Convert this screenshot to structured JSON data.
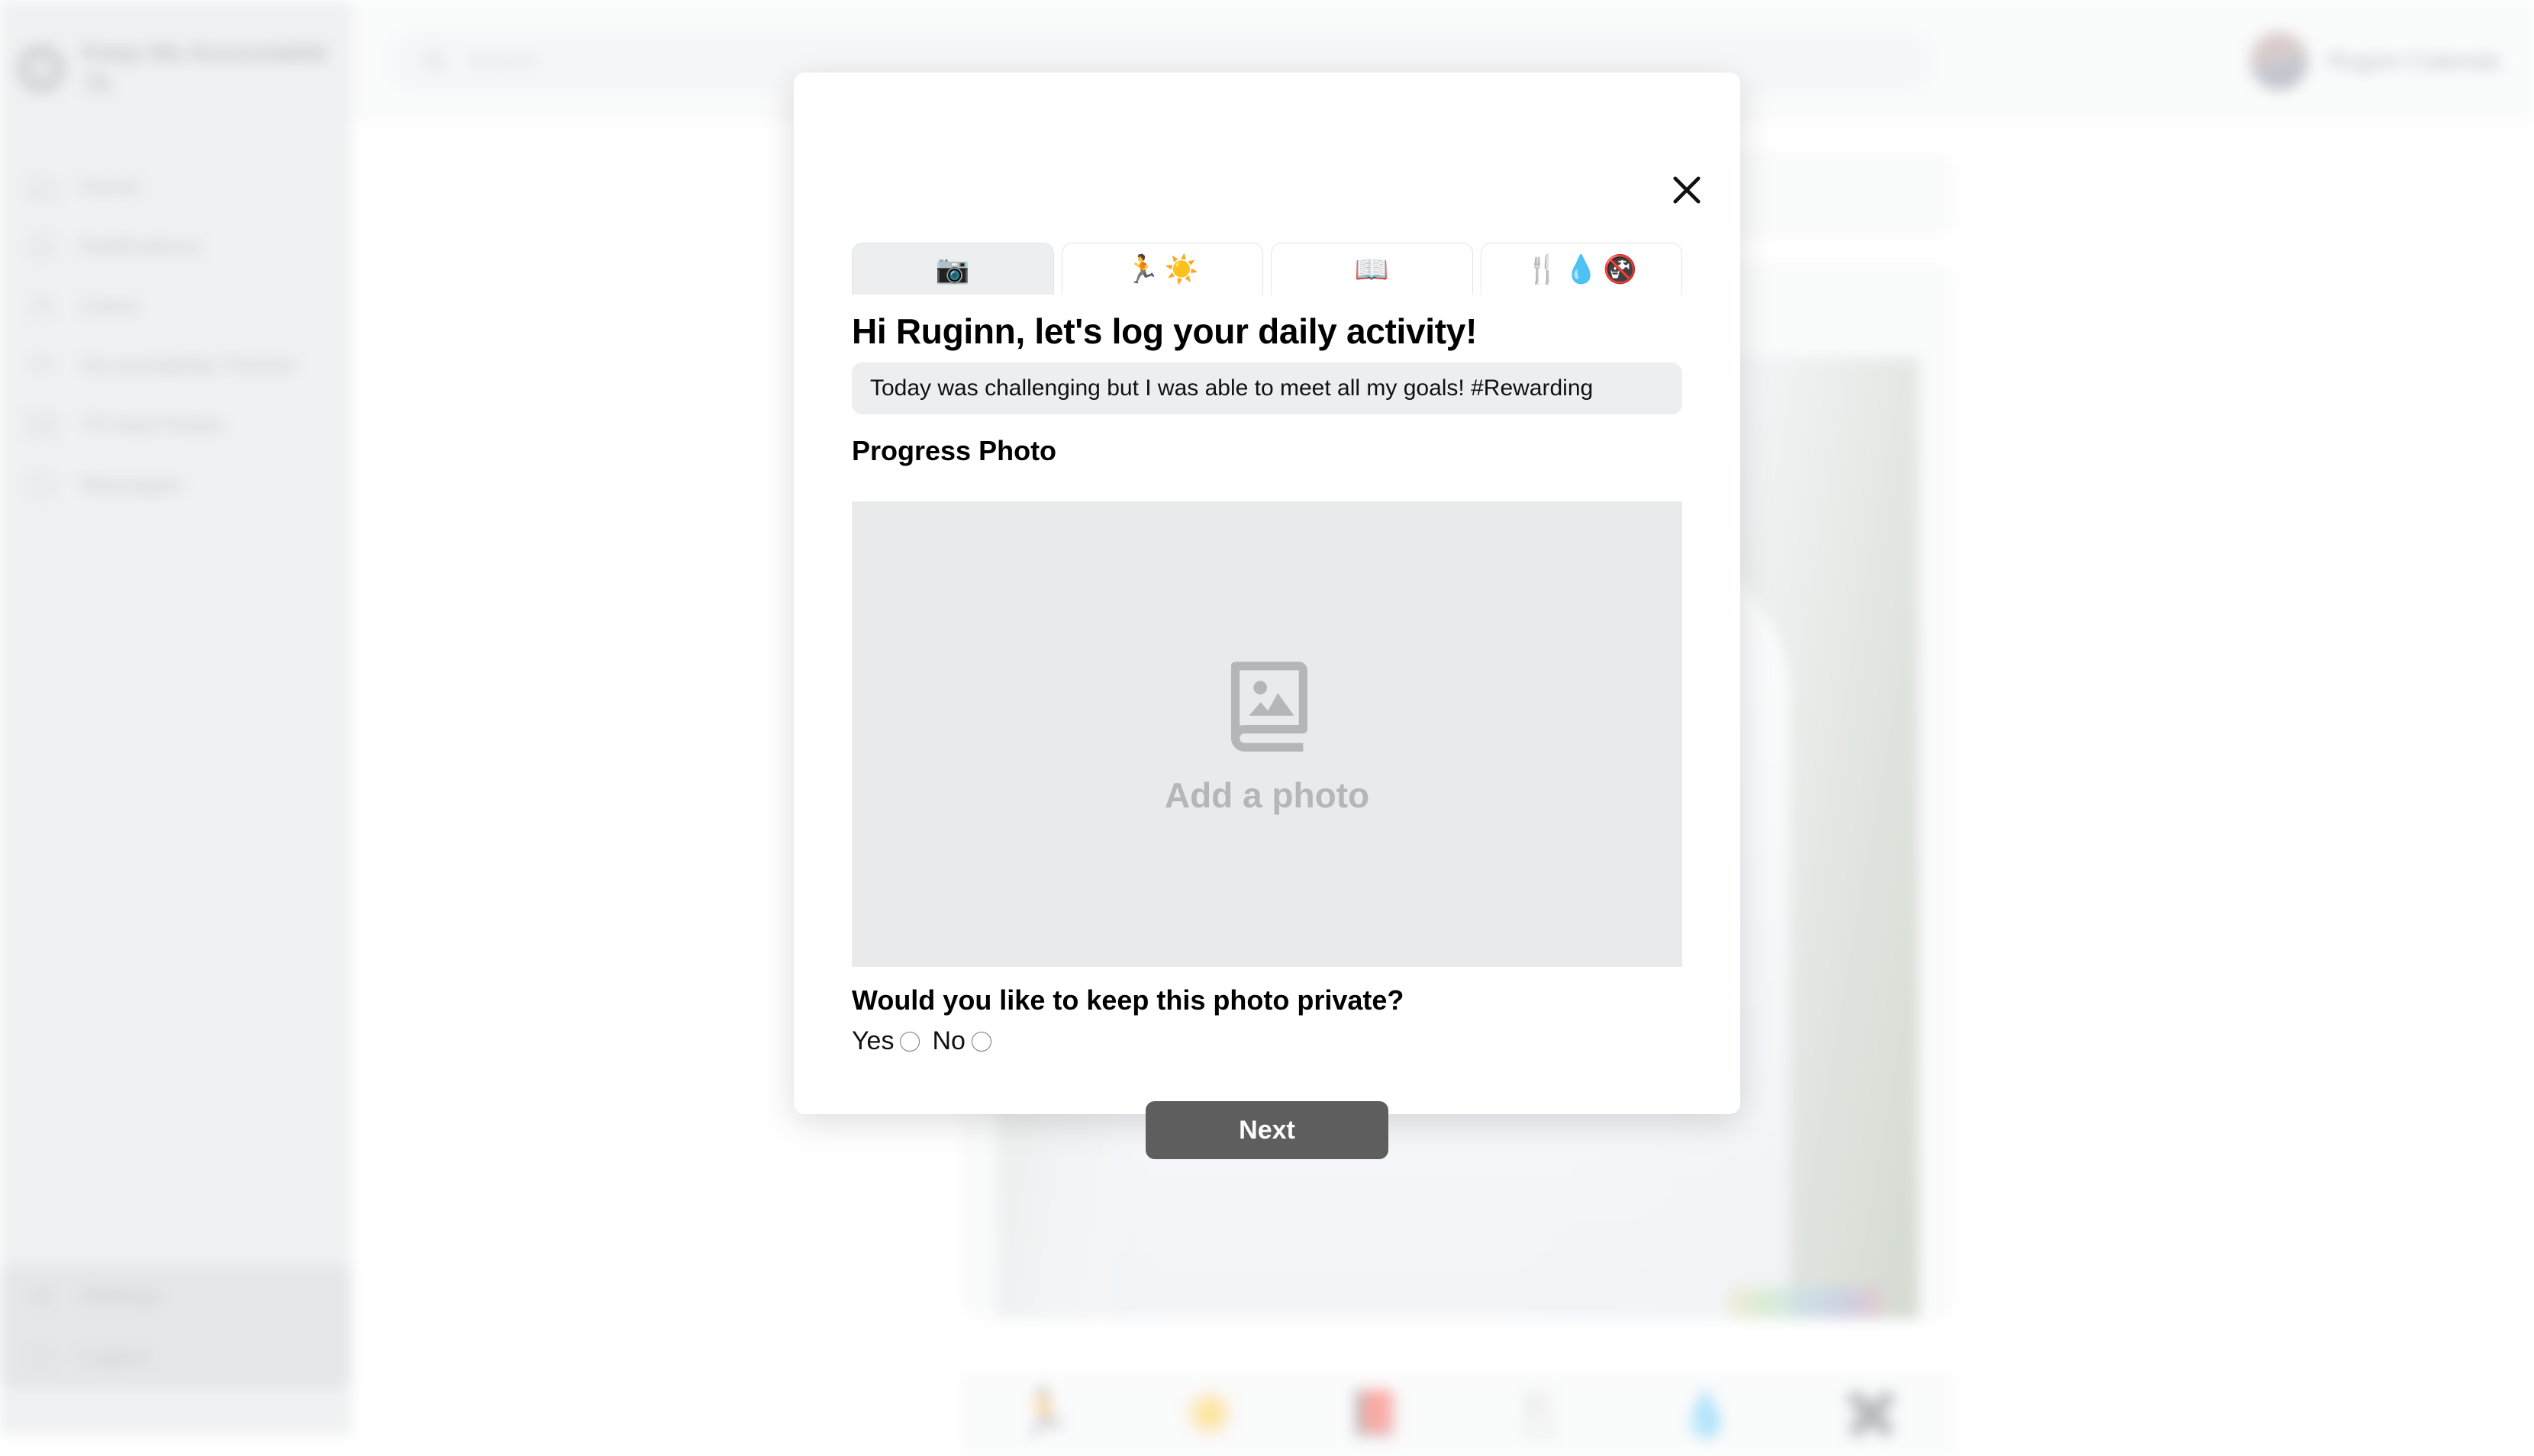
{
  "app": {
    "brand_name": "Keep Me Accountable 75",
    "sidebar": {
      "items": [
        {
          "label": "Home",
          "icon": "home-icon"
        },
        {
          "label": "Notifications",
          "icon": "bell-icon"
        },
        {
          "label": "Users",
          "icon": "user-icon"
        },
        {
          "label": "Accountability Partner",
          "icon": "handshake-icon"
        },
        {
          "label": "75 Hard Rules",
          "icon": "book-icon"
        },
        {
          "label": "Messages",
          "icon": "chat-icon"
        }
      ],
      "bottom_items": [
        {
          "label": "Settings",
          "icon": "gear-icon"
        },
        {
          "label": "Logout",
          "icon": "logout-icon"
        }
      ]
    },
    "topbar": {
      "search_placeholder": "Search...",
      "user_name": "Ruginn Caterate"
    },
    "feed": {
      "post_text": "...s photo",
      "bottom_nav_icons": [
        "🏃",
        "☀️",
        "📕",
        "🍴",
        "💧",
        "✖️"
      ]
    }
  },
  "modal": {
    "close_icon": "close-icon",
    "tabs": [
      {
        "name": "tab-photo",
        "icons": [
          "📷"
        ],
        "active": true
      },
      {
        "name": "tab-activity",
        "icons": [
          "🏃",
          "☀️"
        ],
        "active": false
      },
      {
        "name": "tab-reading",
        "icons": [
          "📖"
        ],
        "active": false
      },
      {
        "name": "tab-diet",
        "icons": [
          "🍴",
          "💧",
          "🚱"
        ],
        "active": false
      }
    ],
    "title": "Hi Ruginn, let's log your daily activity!",
    "note": {
      "value": "Today was challenging but I was able to meet all my goals! #Rewarding",
      "placeholder": "Today was challenging but I was able to meet all my goals! #Rewarding"
    },
    "progress_photo": {
      "section_title": "Progress Photo",
      "placeholder_label": "Add a photo",
      "placeholder_icon": "image-album-icon"
    },
    "privacy": {
      "question": "Would you like to keep this photo private?",
      "option_yes": "Yes",
      "option_no": "No"
    },
    "next_label": "Next"
  },
  "colors": {
    "camera_green": "#1f8a1f",
    "book_red": "#e4393c",
    "water_blue": "#5bc0e8",
    "sun_orange": "#f5a623",
    "button_gray": "#5e5e5e"
  }
}
